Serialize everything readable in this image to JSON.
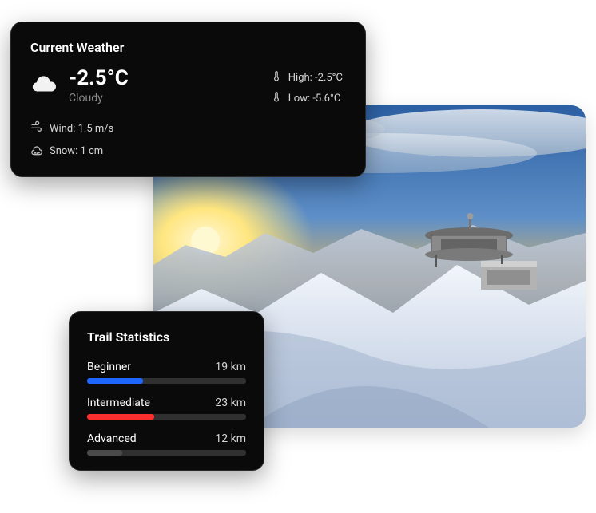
{
  "weather": {
    "title": "Current Weather",
    "temperature": "-2.5°C",
    "condition": "Cloudy",
    "high_label": "High: -2.5°C",
    "low_label": "Low: -5.6°C",
    "wind_label": "Wind: 1.5 m/s",
    "snow_label": "Snow: 1 cm"
  },
  "trails": {
    "title": "Trail Statistics",
    "items": [
      {
        "label": "Beginner",
        "distance": "19 km",
        "color": "#1e66ff",
        "percent": 35
      },
      {
        "label": "Intermediate",
        "distance": "23 km",
        "color": "#ff2e2e",
        "percent": 42
      },
      {
        "label": "Advanced",
        "distance": "12 km",
        "color": "#4a4a4a",
        "percent": 22
      }
    ]
  }
}
